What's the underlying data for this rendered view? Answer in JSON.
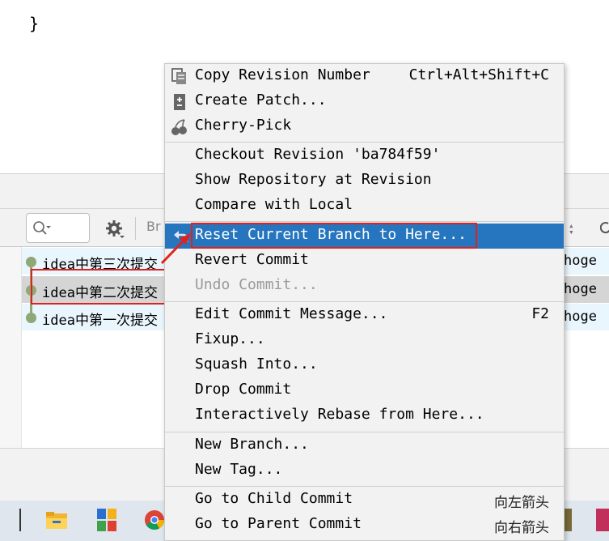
{
  "editor": {
    "closing_brace": "}"
  },
  "toolbar": {
    "branch_filter": "Br"
  },
  "commits": [
    {
      "message": "idea中第三次提交",
      "author": "hoge"
    },
    {
      "message": "idea中第二次提交",
      "author": "hoge"
    },
    {
      "message": "idea中第一次提交",
      "author": "hoge"
    }
  ],
  "menu": {
    "copy_revision": {
      "label": "Copy Revision Number",
      "shortcut": "Ctrl+Alt+Shift+C"
    },
    "create_patch": {
      "label": "Create Patch..."
    },
    "cherry_pick": {
      "label": "Cherry-Pick"
    },
    "checkout_revision": {
      "label": "Checkout Revision 'ba784f59'"
    },
    "show_repository": {
      "label": "Show Repository at Revision"
    },
    "compare_local": {
      "label": "Compare with Local"
    },
    "reset_branch": {
      "label": "Reset Current Branch to Here..."
    },
    "revert_commit": {
      "label": "Revert Commit"
    },
    "undo_commit": {
      "label": "Undo Commit..."
    },
    "edit_message": {
      "label": "Edit Commit Message...",
      "shortcut": "F2"
    },
    "fixup": {
      "label": "Fixup..."
    },
    "squash_into": {
      "label": "Squash Into..."
    },
    "drop_commit": {
      "label": "Drop Commit"
    },
    "interactive_rebase": {
      "label": "Interactively Rebase from Here..."
    },
    "new_branch": {
      "label": "New Branch..."
    },
    "new_tag": {
      "label": "New Tag..."
    },
    "go_child": {
      "label": "Go to Child Commit",
      "shortcut": "向左箭头"
    },
    "go_parent": {
      "label": "Go to Parent Commit",
      "shortcut": "向右箭头"
    }
  },
  "colors": {
    "selection": "#2675bf",
    "highlight_box": "#e2211c",
    "graph": "#8fa876",
    "row_highlight": "#eaf6fd"
  },
  "icons": [
    "copy-icon",
    "patch-icon",
    "cherry-icon",
    "reset-icon",
    "search-icon",
    "gear-icon",
    "folder-icon",
    "chrome-icon"
  ]
}
